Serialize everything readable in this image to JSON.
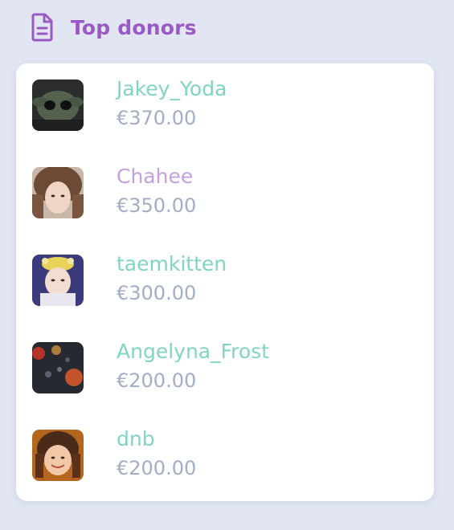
{
  "header": {
    "title": "Top donors",
    "icon": "document-icon",
    "title_color": "#9b59c6"
  },
  "donors": [
    {
      "name": "Jakey_Yoda",
      "amount": "€370.00",
      "name_color": "#7fd5c3"
    },
    {
      "name": "Chahee",
      "amount": "€350.00",
      "name_color": "#c4a0dd"
    },
    {
      "name": "taemkitten",
      "amount": "€300.00",
      "name_color": "#7fd5c3"
    },
    {
      "name": "Angelyna_Frost",
      "amount": "€200.00",
      "name_color": "#7fd5c3"
    },
    {
      "name": "dnb",
      "amount": "€200.00",
      "name_color": "#7fd5c3"
    }
  ]
}
